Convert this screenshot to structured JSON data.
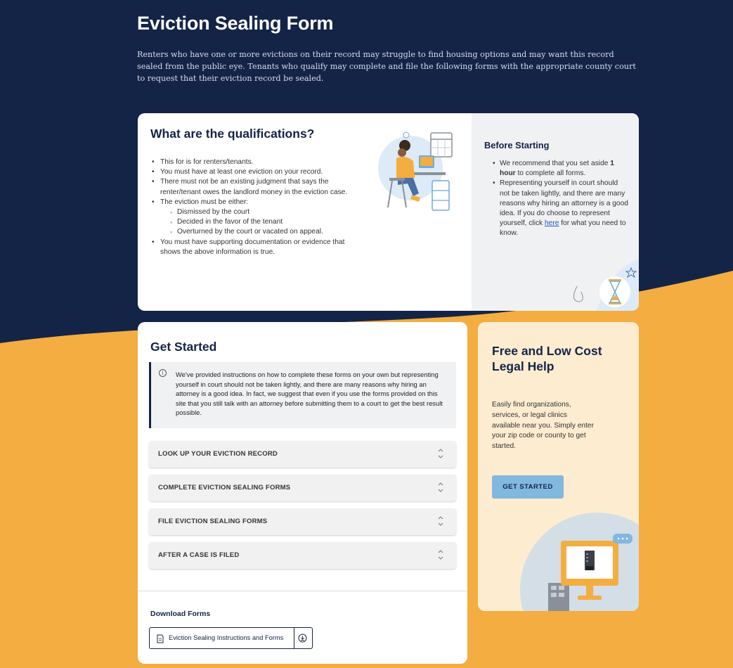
{
  "hero": {
    "title": "Eviction Sealing Form",
    "description": "Renters who have one or more evictions on their record may struggle to find housing options and may want this record sealed from the public eye. Tenants who qualify may complete and file the following forms with the appropriate county court to request that their eviction record be sealed."
  },
  "qualifications": {
    "title": "What are the qualifications?",
    "items": [
      "This for is for renters/tenants.",
      "You must have at least one eviction on your record.",
      "There must not be an existing judgment that says the renter/tenant owes the landlord money in the eviction case.",
      "The eviction must be either:"
    ],
    "sub_items": [
      "Dismissed by the court",
      "Decided in the favor of the tenant",
      "Overturned by the court or vacated on appeal."
    ],
    "last_item": "You must have supporting documentation or evidence that shows the above information is true."
  },
  "before_starting": {
    "title": "Before Starting",
    "item1_pre": "We recommend that you set aside ",
    "item1_bold": "1 hour",
    "item1_post": " to complete all forms.",
    "item2_pre": "Representing yourself in court should not be taken lightly, and there are many reasons why hiring an attorney is a good idea. If you do choose to represent yourself, click ",
    "item2_link": "here",
    "item2_post": " for what you need to know."
  },
  "get_started": {
    "title": "Get Started",
    "notice_icon": "info-icon",
    "notice": "We've provided instructions on how to complete these forms on your own but representing yourself in court should not be taken lightly, and there are many reasons why hiring an attorney is a good idea. In fact, we suggest that even if you use the forms provided on this site that you still talk with an attorney before submitting them to a court to get the best result possible.",
    "accordions": [
      "LOOK UP YOUR EVICTION RECORD",
      "COMPLETE EVICTION SEALING FORMS",
      "FILE EVICTION SEALING FORMS",
      "AFTER A CASE IS FILED"
    ],
    "download_title": "Download Forms",
    "download_label": "Eviction Sealing Instructions and Forms"
  },
  "legal_help": {
    "title": "Free and Low Cost Legal Help",
    "description": "Easily find organizations, services, or legal clinics available near you. Simply enter your zip code or county to get started.",
    "button_label": "GET STARTED"
  },
  "colors": {
    "navy": "#142447",
    "orange": "#f4ad40",
    "light_blue": "#82b7e0",
    "cream": "#fdecd0"
  }
}
